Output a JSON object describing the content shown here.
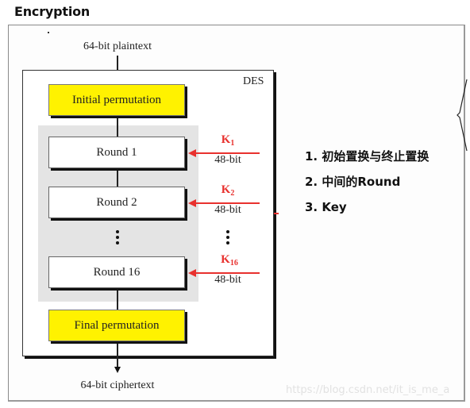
{
  "title": "Encryption",
  "diagram": {
    "container_label": "DES",
    "input_label": "64-bit plaintext",
    "output_label": "64-bit ciphertext",
    "initial_permutation": "Initial permutation",
    "final_permutation": "Final permutation",
    "rounds": [
      {
        "label": "Round 1",
        "key": "K",
        "key_sub": "1",
        "key_bits": "48-bit"
      },
      {
        "label": "Round 2",
        "key": "K",
        "key_sub": "2",
        "key_bits": "48-bit"
      },
      {
        "label": "Round 16",
        "key": "K",
        "key_sub": "16",
        "key_bits": "48-bit"
      }
    ],
    "colors": {
      "permutation_fill": "#fff200",
      "key_arrow": "#e8312e",
      "round_zone": "#e4e4e4"
    }
  },
  "notes": [
    "1. 初始置换与终止置换",
    "2. 中间的Round",
    "3. Key"
  ],
  "watermark": "https://blog.csdn.net/it_is_me_a"
}
